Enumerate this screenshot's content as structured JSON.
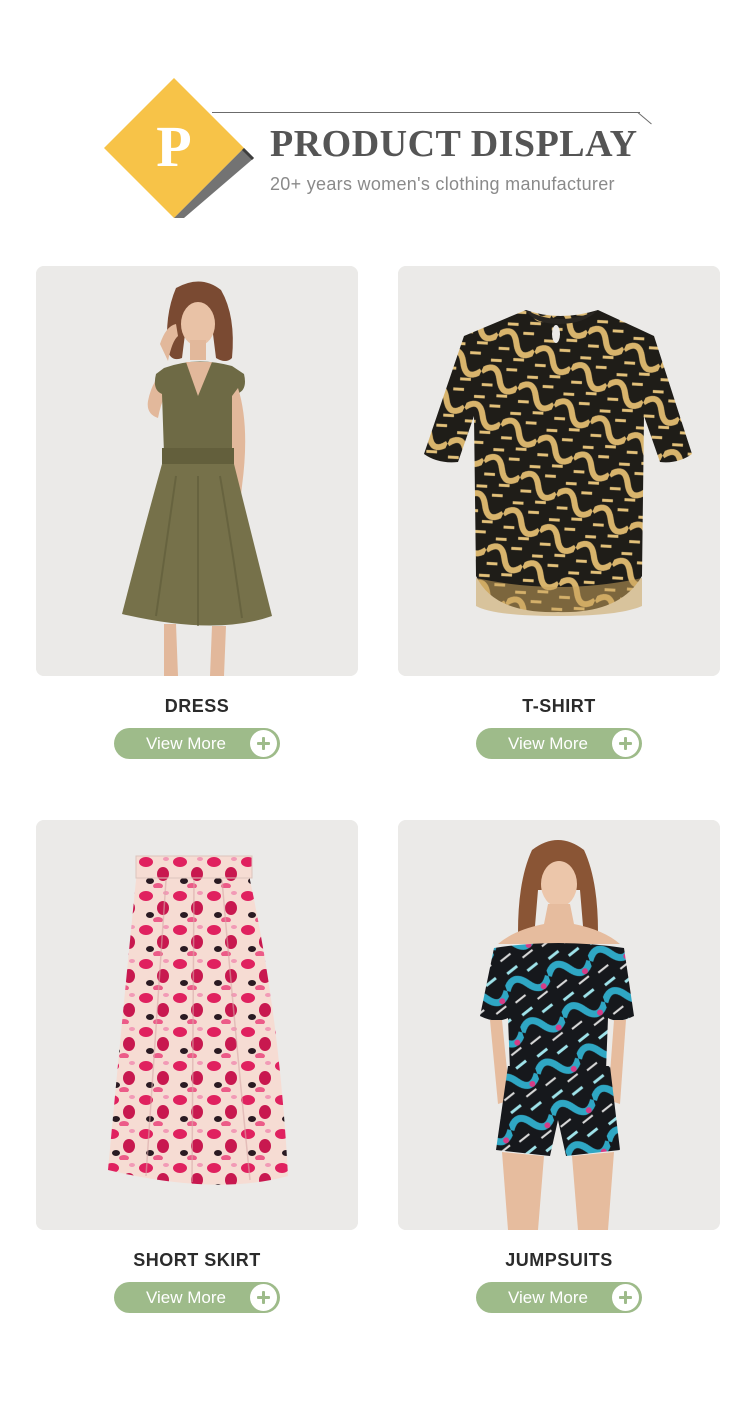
{
  "header": {
    "logo_letter": "P",
    "title": "PRODUCT DISPLAY",
    "subtitle": "20+ years women's clothing manufacturer",
    "colors": {
      "logo": "#f7c348",
      "title": "#555555",
      "subtitle": "#8a8a8a"
    }
  },
  "products": [
    {
      "label": "DRESS",
      "button": "View More",
      "image_icon": "olive-wrap-dress-photo"
    },
    {
      "label": "T-SHIRT",
      "button": "View More",
      "image_icon": "leaf-print-tshirt-photo"
    },
    {
      "label": "SHORT SKIRT",
      "button": "View More",
      "image_icon": "pink-floral-skirt-photo"
    },
    {
      "label": "JUMPSUITS",
      "button": "View More",
      "image_icon": "tropical-print-jumpsuit-photo"
    }
  ],
  "theme": {
    "button_color": "#9ebb8a",
    "card_background": "#ebeae8"
  }
}
